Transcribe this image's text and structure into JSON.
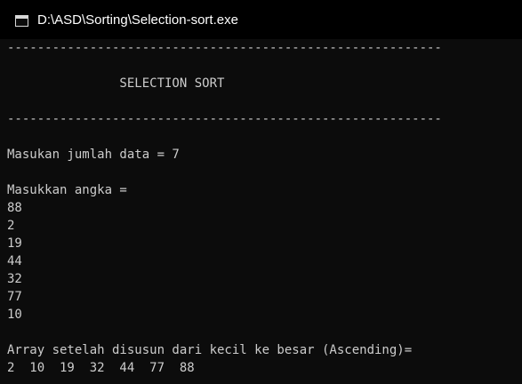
{
  "window": {
    "title": "D:\\ASD\\Sorting\\Selection-sort.exe",
    "icon": "console-window-icon"
  },
  "console": {
    "lines": [
      "----------------------------------------------------------",
      "",
      "               SELECTION SORT",
      "",
      "----------------------------------------------------------",
      "",
      "Masukan jumlah data = 7",
      "",
      "Masukkan angka =",
      "88",
      "2",
      "19",
      "44",
      "32",
      "77",
      "10",
      "",
      "Array setelah disusun dari kecil ke besar (Ascending)=",
      "2  10  19  32  44  77  88"
    ]
  },
  "colors": {
    "background": "#0c0c0c",
    "text": "#cccccc",
    "titlebar": "#000000",
    "title_text": "#ffffff"
  }
}
